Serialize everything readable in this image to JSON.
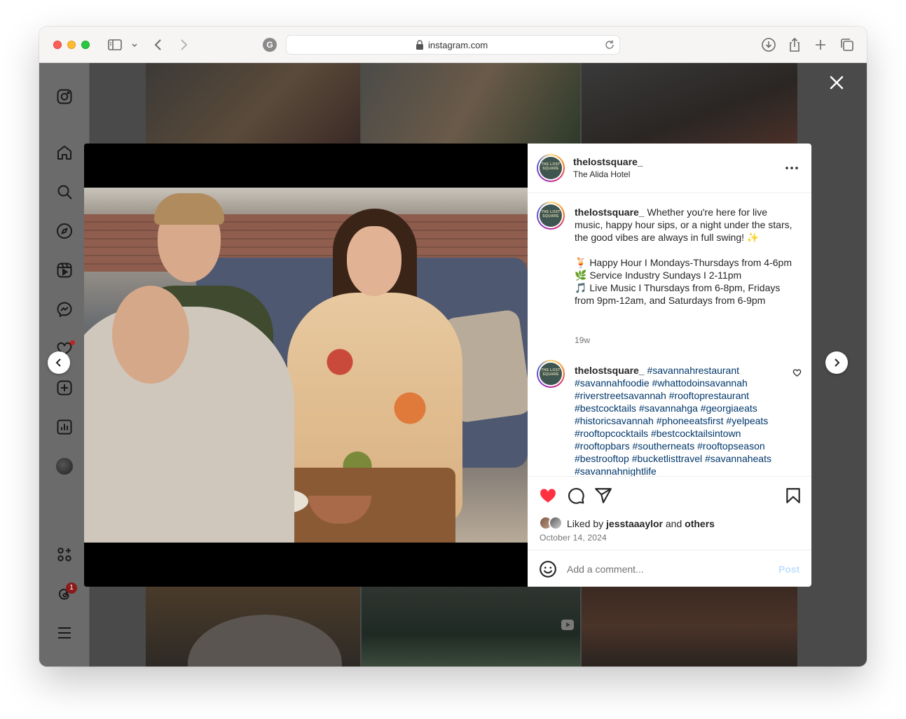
{
  "browser": {
    "url": "instagram.com",
    "grammarly_label": "G"
  },
  "sidebar": {
    "threads_badge": "1"
  },
  "post": {
    "username": "thelostsquare_",
    "location": "The Alida Hotel",
    "avatar_text": "THE LOST SQUARE",
    "caption_lines": [
      "Whether you're here for live music, happy hour sips, or a night under the stars, the good vibes are always in full swing! ✨",
      "",
      "🍹 Happy Hour I Mondays-Thursdays from 4-6pm",
      "🌿 Service Industry Sundays I 2-11pm",
      "🎵 Live Music I Thursdays from 6-8pm, Fridays from 9pm-12am, and Saturdays from 6-9pm"
    ],
    "caption_time": "19w",
    "hashtags": [
      "#savannahrestaurant",
      "#savannahfoodie",
      "#whattodoinsavannah",
      "#riverstreetsavannah",
      "#rooftoprestaurant",
      "#bestcocktails",
      "#savannahga",
      "#georgiaeats",
      "#historicsavannah",
      "#phoneeatsfirst",
      "#yelpeats",
      "#rooftopcocktails",
      "#bestcocktailsintown",
      "#rooftopbars",
      "#southerneats",
      "#rooftopseason",
      "#bestrooftop",
      "#bucketlisttravel",
      "#savannaheats",
      "#savannahnightlife"
    ],
    "liked_by_prefix": "Liked by",
    "liked_by_user": "jesstaaaylor",
    "liked_by_and": "and",
    "liked_by_others": "others",
    "date": "October 14, 2024"
  },
  "comment_box": {
    "placeholder": "Add a comment...",
    "post_label": "Post"
  },
  "colors": {
    "like_red": "#ff3040",
    "hashtag_blue": "#00376b",
    "post_disabled": "#c0dffd"
  }
}
